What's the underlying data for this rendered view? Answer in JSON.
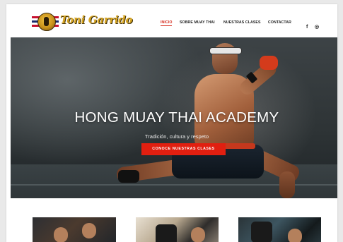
{
  "header": {
    "logo_text": "Toni Garrido",
    "nav": [
      {
        "label": "INICIO",
        "active": true
      },
      {
        "label": "SOBRE MUAY THAI",
        "active": false
      },
      {
        "label": "NUESTRAS CLASES",
        "active": false
      },
      {
        "label": "CONTACTAR",
        "active": false
      }
    ],
    "social": [
      {
        "icon": "facebook-icon",
        "glyph": "f"
      },
      {
        "icon": "instagram-icon",
        "glyph": "◎"
      }
    ]
  },
  "hero": {
    "title": "HONG MUAY THAI ACADEMY",
    "subtitle": "Tradición, cultura y respeto",
    "cta_label": "CONOCE NUESTRAS CLASES"
  },
  "colors": {
    "accent": "#e11f10",
    "nav_active": "#d62a1c",
    "logo_gold": "#d7a521"
  }
}
